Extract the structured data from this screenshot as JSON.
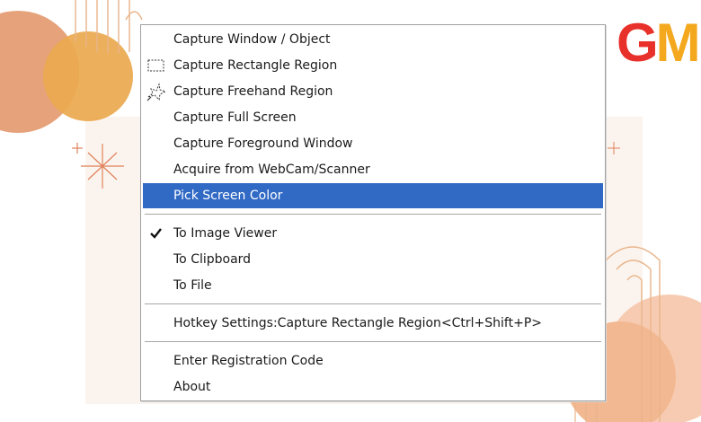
{
  "brand": {
    "logo_g": "G",
    "logo_m": "M"
  },
  "menu": {
    "capture_items": [
      {
        "label": "Capture Window / Object",
        "icon": ""
      },
      {
        "label": "Capture Rectangle Region",
        "icon": "dotted-rectangle-icon"
      },
      {
        "label": "Capture Freehand Region",
        "icon": "freehand-region-icon"
      },
      {
        "label": "Capture Full Screen",
        "icon": ""
      },
      {
        "label": "Capture Foreground Window",
        "icon": ""
      },
      {
        "label": "Acquire from WebCam/Scanner",
        "icon": ""
      },
      {
        "label": "Pick Screen Color",
        "icon": "",
        "highlighted": true
      }
    ],
    "output_items": [
      {
        "label": "To Image Viewer",
        "checked": true,
        "icon": "checkmark-icon"
      },
      {
        "label": "To Clipboard",
        "checked": false
      },
      {
        "label": "To File",
        "checked": false
      }
    ],
    "hotkey": {
      "label": "Hotkey Settings:Capture Rectangle Region<Ctrl+Shift+P>"
    },
    "misc_items": [
      {
        "label": "Enter Registration Code"
      },
      {
        "label": "About"
      }
    ]
  },
  "colors": {
    "highlight": "#316ac5",
    "logo_red": "#e8312a",
    "logo_orange": "#f4a81d",
    "decor_peach": "#e8a87c"
  }
}
